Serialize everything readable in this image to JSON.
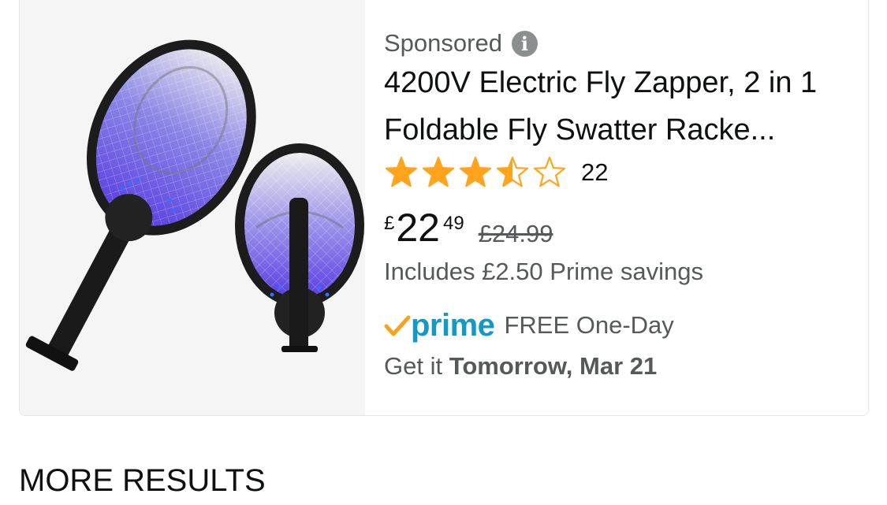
{
  "product": {
    "sponsored_label": "Sponsored",
    "info_icon": "i",
    "title": "4200V Electric Fly Zapper, 2 in 1 Foldable Fly Swatter Racke...",
    "rating": {
      "stars": 3.5,
      "out_of": 5,
      "count": "22"
    },
    "price": {
      "currency": "£",
      "whole": "22",
      "fraction": "49",
      "was": "£24.99"
    },
    "savings_text": "Includes £2.50 Prime savings",
    "prime": {
      "logo_text": "prime",
      "delivery_label": "FREE One-Day"
    },
    "delivery": {
      "prefix": "Get it ",
      "date": "Tomorrow, Mar 21"
    },
    "image_icon": "electric-fly-swatter-image"
  },
  "section": {
    "title": "MORE RESULTS"
  },
  "colors": {
    "star": "#ffa41c",
    "prime_blue": "#1399c6",
    "prime_check": "#f7a21b",
    "text": "#0f1111",
    "muted": "#565959"
  }
}
